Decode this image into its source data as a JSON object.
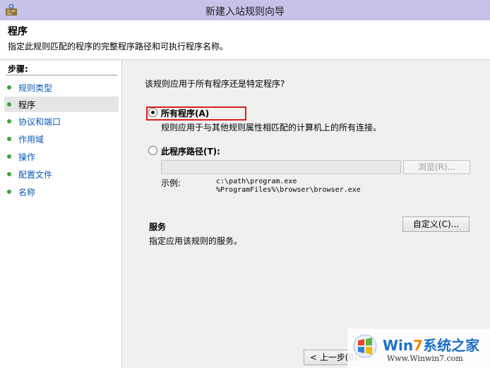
{
  "window": {
    "title": "新建入站规则向导"
  },
  "header": {
    "title": "程序",
    "description": "指定此规则匹配的程序的完整程序路径和可执行程序名称。"
  },
  "sidebar": {
    "steps_title": "步骤:",
    "items": [
      {
        "label": "规则类型",
        "active": false
      },
      {
        "label": "程序",
        "active": true
      },
      {
        "label": "协议和端口",
        "active": false
      },
      {
        "label": "作用域",
        "active": false
      },
      {
        "label": "操作",
        "active": false
      },
      {
        "label": "配置文件",
        "active": false
      },
      {
        "label": "名称",
        "active": false
      }
    ]
  },
  "content": {
    "question": "该规则应用于所有程序还是特定程序?",
    "option_all": {
      "label": "所有程序(A)",
      "description": "规则应用于与其他规则属性相匹配的计算机上的所有连接。",
      "checked": true
    },
    "option_path": {
      "label": "此程序路径(T):",
      "checked": false,
      "value": ""
    },
    "browse_label": "浏览(R)...",
    "example_label": "示例:",
    "example_path_1": "c:\\path\\program.exe",
    "example_path_2": "%ProgramFiles%\\browser\\browser.exe",
    "services_title": "服务",
    "services_desc": "指定应用该规则的服务。",
    "customize_label": "自定义(C)..."
  },
  "footer": {
    "back_label": "< 上一步(B)"
  },
  "watermark": {
    "win": "Win",
    "num": "7",
    "cn": "系统之家",
    "url": "Www.Winwin7.com"
  },
  "colors": {
    "titlebar": "#c7c3e8",
    "link": "#0b59b5",
    "step_dot": "#3aa63a",
    "highlight": "#d9201a"
  }
}
